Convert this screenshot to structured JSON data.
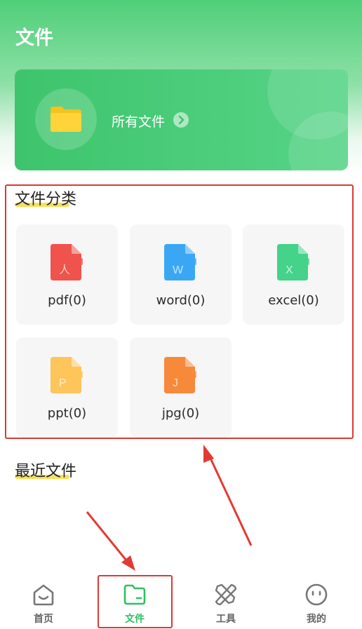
{
  "header": {
    "title": "文件"
  },
  "all_files": {
    "label": "所有文件",
    "icon": "folder-icon",
    "accent": "#ffd43b"
  },
  "categories": {
    "title": "文件分类",
    "items": [
      {
        "label": "pdf(0)",
        "icon": "pdf-file-icon",
        "color": "#f0524c",
        "letter": "人"
      },
      {
        "label": "word(0)",
        "icon": "word-file-icon",
        "color": "#3aa7f5",
        "letter": "W"
      },
      {
        "label": "excel(0)",
        "icon": "excel-file-icon",
        "color": "#45d28a",
        "letter": "X"
      },
      {
        "label": "ppt(0)",
        "icon": "ppt-file-icon",
        "color": "#fdc55a",
        "letter": "P"
      },
      {
        "label": "jpg(0)",
        "icon": "jpg-file-icon",
        "color": "#f7893a",
        "letter": "J"
      }
    ]
  },
  "recent": {
    "title": "最近文件"
  },
  "nav": {
    "items": [
      {
        "label": "首页",
        "icon": "home-icon"
      },
      {
        "label": "文件",
        "icon": "folder-icon",
        "active": true
      },
      {
        "label": "工具",
        "icon": "tools-icon"
      },
      {
        "label": "我的",
        "icon": "profile-icon"
      }
    ]
  },
  "colors": {
    "brand": "#2fbf62",
    "highlight": "#d93a36"
  }
}
